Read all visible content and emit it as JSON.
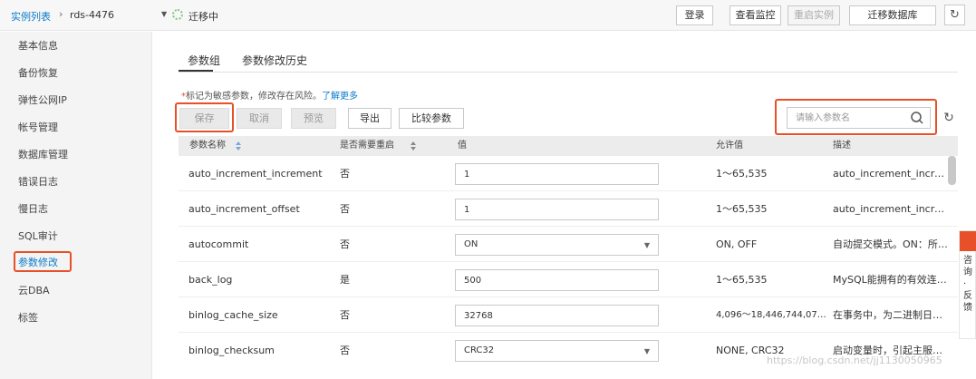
{
  "header": {
    "breadcrumb_link": "实例列表",
    "breadcrumb_sep": "›",
    "instance_name": "rds-4476",
    "status_text": "迁移中",
    "buttons": {
      "login": "登录",
      "monitor": "查看监控",
      "restart": "重启实例",
      "migrate": "迁移数据库"
    }
  },
  "sidebar": {
    "items": [
      {
        "label": "基本信息"
      },
      {
        "label": "备份恢复"
      },
      {
        "label": "弹性公网IP"
      },
      {
        "label": "帐号管理"
      },
      {
        "label": "数据库管理"
      },
      {
        "label": "错误日志"
      },
      {
        "label": "慢日志"
      },
      {
        "label": "SQL审计"
      },
      {
        "label": "参数修改"
      },
      {
        "label": "云DBA"
      },
      {
        "label": "标签"
      }
    ]
  },
  "tabs": [
    {
      "label": "参数组"
    },
    {
      "label": "参数修改历史"
    }
  ],
  "notice": {
    "star": "*",
    "text": "标记为敏感参数，修改存在风险。",
    "link": "了解更多"
  },
  "actions": {
    "save": "保存",
    "cancel": "取消",
    "preview": "预览",
    "export": "导出",
    "compare": "比较参数"
  },
  "search": {
    "placeholder": "请输入参数名"
  },
  "table": {
    "columns": [
      "参数名称",
      "是否需要重启",
      "值",
      "允许值",
      "描述"
    ],
    "rows": [
      {
        "name": "auto_increment_increment",
        "restart": "否",
        "value": "1",
        "type": "input",
        "allowed": "1～65,535",
        "desc": "auto_increment_increm…"
      },
      {
        "name": "auto_increment_offset",
        "restart": "否",
        "value": "1",
        "type": "input",
        "allowed": "1～65,535",
        "desc": "auto_increment_increm…"
      },
      {
        "name": "autocommit",
        "restart": "否",
        "value": "ON",
        "type": "select",
        "allowed": "ON, OFF",
        "desc": "自动提交模式。ON：所…"
      },
      {
        "name": "back_log",
        "restart": "是",
        "value": "500",
        "type": "input",
        "allowed": "1～65,535",
        "desc": "MySQL能拥有的有效连…"
      },
      {
        "name": "binlog_cache_size",
        "restart": "否",
        "value": "32768",
        "type": "input",
        "allowed": "4,096～18,446,744,07…",
        "desc": "在事务中，为二进制日…"
      },
      {
        "name": "binlog_checksum",
        "restart": "否",
        "value": "CRC32",
        "type": "select",
        "allowed": "NONE, CRC32",
        "desc": "启动变量时，引起主服…"
      }
    ]
  },
  "float_consult": {
    "text": "咨询·反馈"
  },
  "watermark": "https://blog.csdn.net/jj1130050965"
}
